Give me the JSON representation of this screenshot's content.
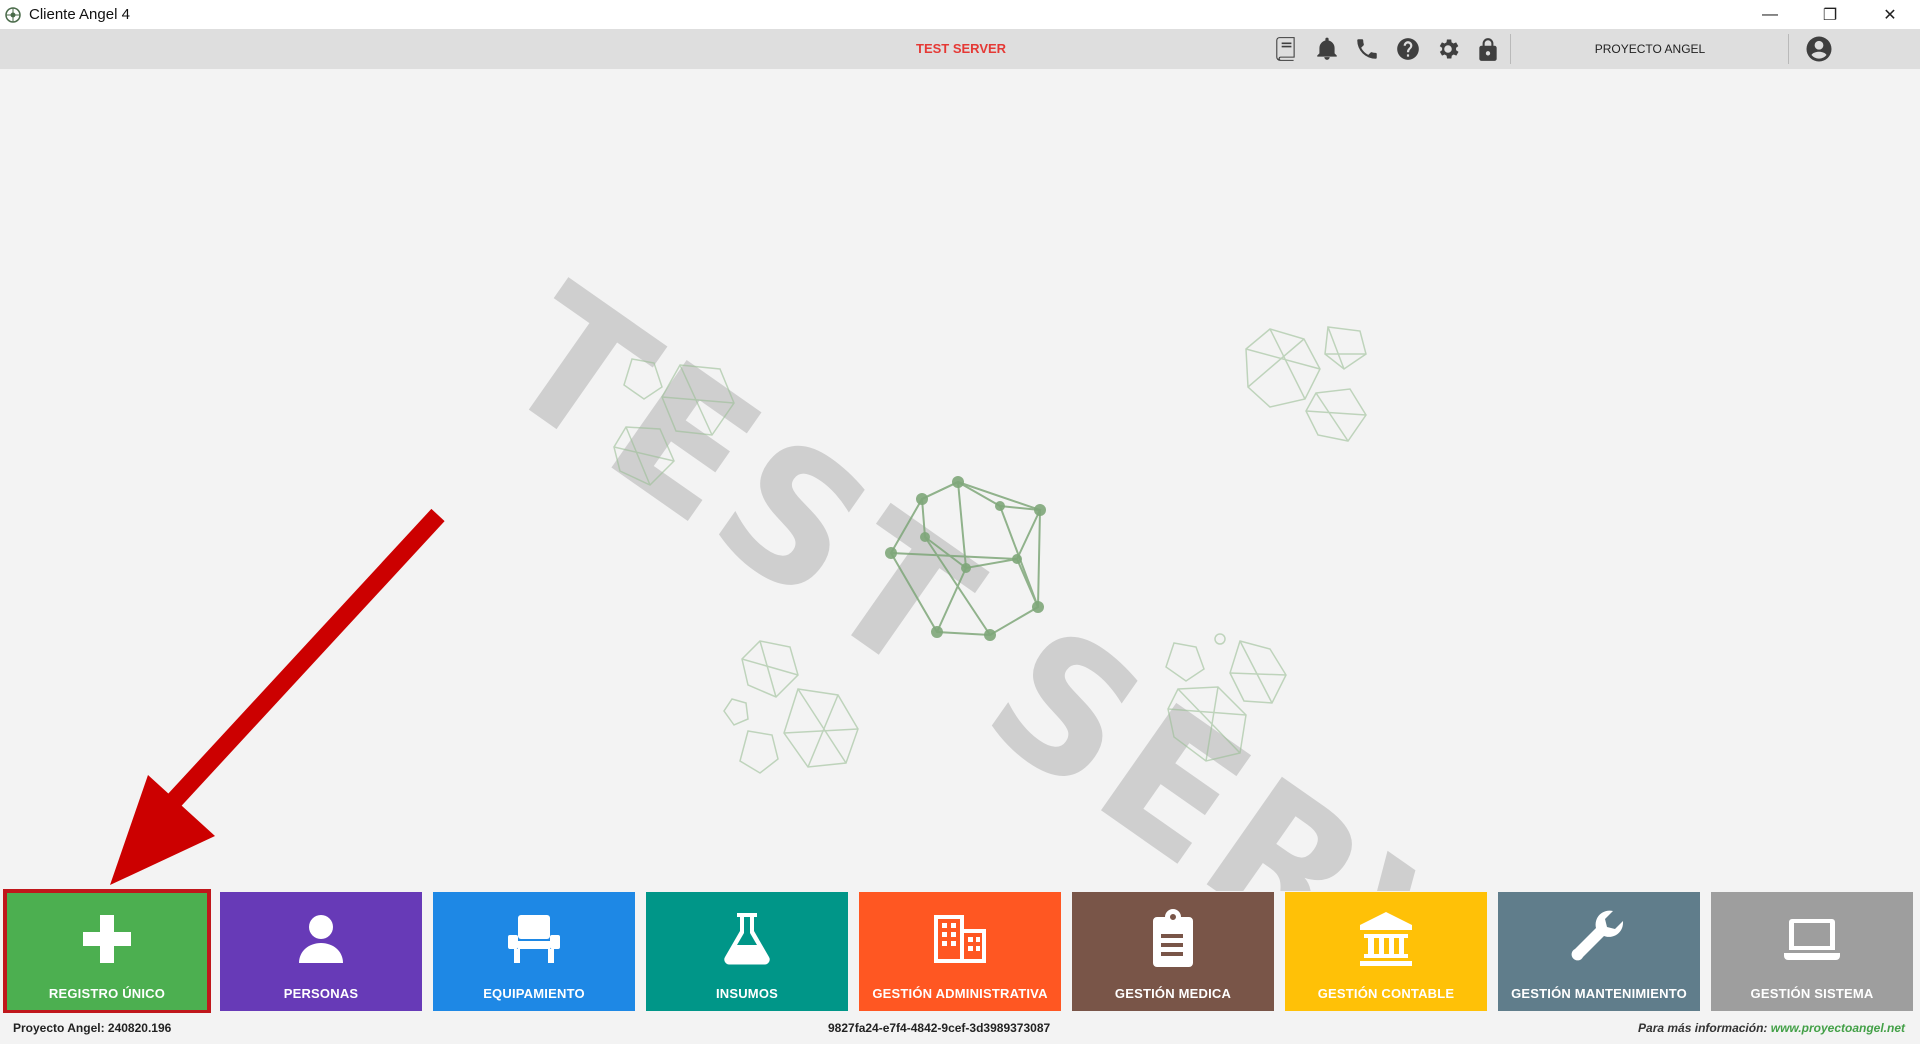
{
  "window": {
    "title": "Cliente Angel 4",
    "controls": {
      "minimize": "—",
      "restore": "❐",
      "close": "✕"
    }
  },
  "toolbar": {
    "server_label": "TEST SERVER",
    "project_label": "PROYECTO ANGEL",
    "icons": [
      "book-icon",
      "bell-icon",
      "phone-icon",
      "help-icon",
      "gear-icon",
      "lock-icon",
      "user-account-icon"
    ]
  },
  "main": {
    "watermark": "TEST SERVER"
  },
  "tiles": [
    {
      "label": "REGISTRO ÚNICO",
      "color": "#4caf50",
      "icon": "plus-icon",
      "selected": true
    },
    {
      "label": "PERSONAS",
      "color": "#673ab7",
      "icon": "person-icon"
    },
    {
      "label": "EQUIPAMIENTO",
      "color": "#1e88e5",
      "icon": "chair-icon"
    },
    {
      "label": "INSUMOS",
      "color": "#009688",
      "icon": "flask-icon"
    },
    {
      "label": "GESTIÓN ADMINISTRATIVA",
      "color": "#ff5722",
      "icon": "building-icon"
    },
    {
      "label": "GESTIÓN MEDICA",
      "color": "#795548",
      "icon": "clipboard-icon"
    },
    {
      "label": "GESTIÓN CONTABLE",
      "color": "#ffc107",
      "icon": "bank-icon"
    },
    {
      "label": "GESTIÓN MANTENIMIENTO",
      "color": "#607d8b",
      "icon": "wrench-icon"
    },
    {
      "label": "GESTIÓN SISTEMA",
      "color": "#9e9e9e",
      "icon": "laptop-icon"
    }
  ],
  "statusbar": {
    "version": "Proyecto Angel: 240820.196",
    "session_id": "9827fa24-e7f4-4842-9cef-3d3989373087",
    "info_text": "Para más información:",
    "info_url": "www.proyectoangel.net"
  },
  "colors": {
    "toolbar_bg": "#dedede",
    "server_label": "#e53935",
    "selection_outline": "#c0171b",
    "annotation_arrow": "#cc0000"
  }
}
